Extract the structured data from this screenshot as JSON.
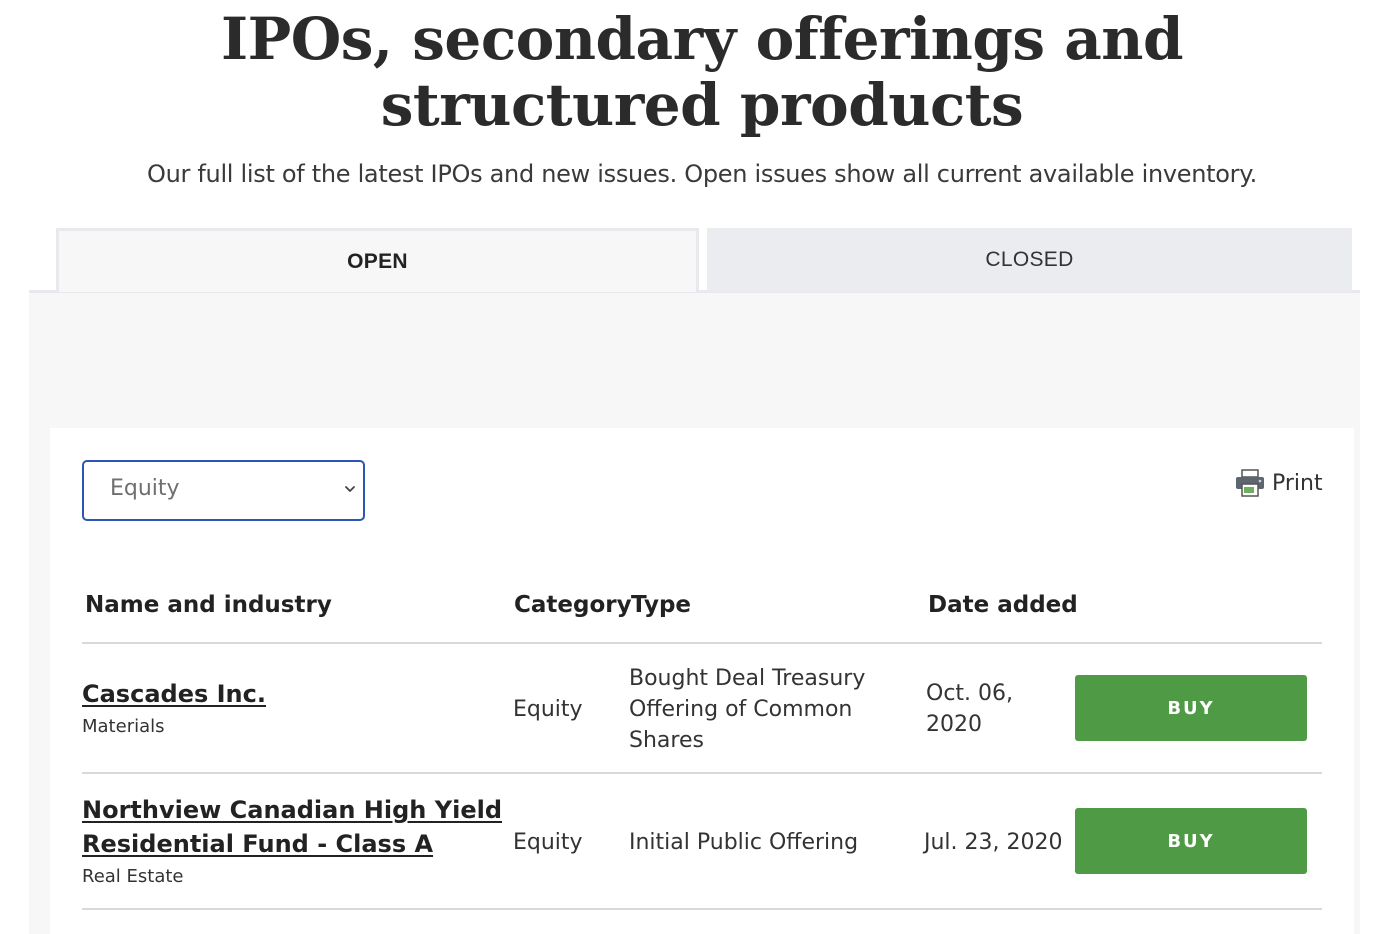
{
  "header": {
    "title": "IPOs, secondary offerings and structured products",
    "subtitle": "Our full list of the latest IPOs and new issues. Open issues show all current available inventory."
  },
  "tabs": [
    {
      "label": "OPEN",
      "active": true
    },
    {
      "label": "CLOSED",
      "active": false
    }
  ],
  "filter": {
    "selected": "Equity",
    "icon": "chevron-down-icon"
  },
  "print": {
    "label": "Print",
    "icon": "printer-icon"
  },
  "table": {
    "columns": [
      "Name and industry",
      "Category",
      "Type",
      "Date added"
    ],
    "rows": [
      {
        "name": "Cascades Inc.",
        "industry": "Materials",
        "category": "Equity",
        "type_lines": [
          "Bought Deal Treasury",
          "Offering of Common",
          "Shares"
        ],
        "date_lines": [
          "Oct. 06,",
          "2020"
        ],
        "action": "BUY"
      },
      {
        "name_lines": [
          "Northview Canadian High Yield",
          "Residential Fund - Class A"
        ],
        "industry": "Real Estate",
        "category": "Equity",
        "type": "Initial Public Offering",
        "date": "Jul. 23, 2020",
        "action": "BUY"
      }
    ]
  },
  "colors": {
    "buy_button": "#4e9a45",
    "select_border": "#2a56b8",
    "tab_panel": "#f7f7f8"
  }
}
